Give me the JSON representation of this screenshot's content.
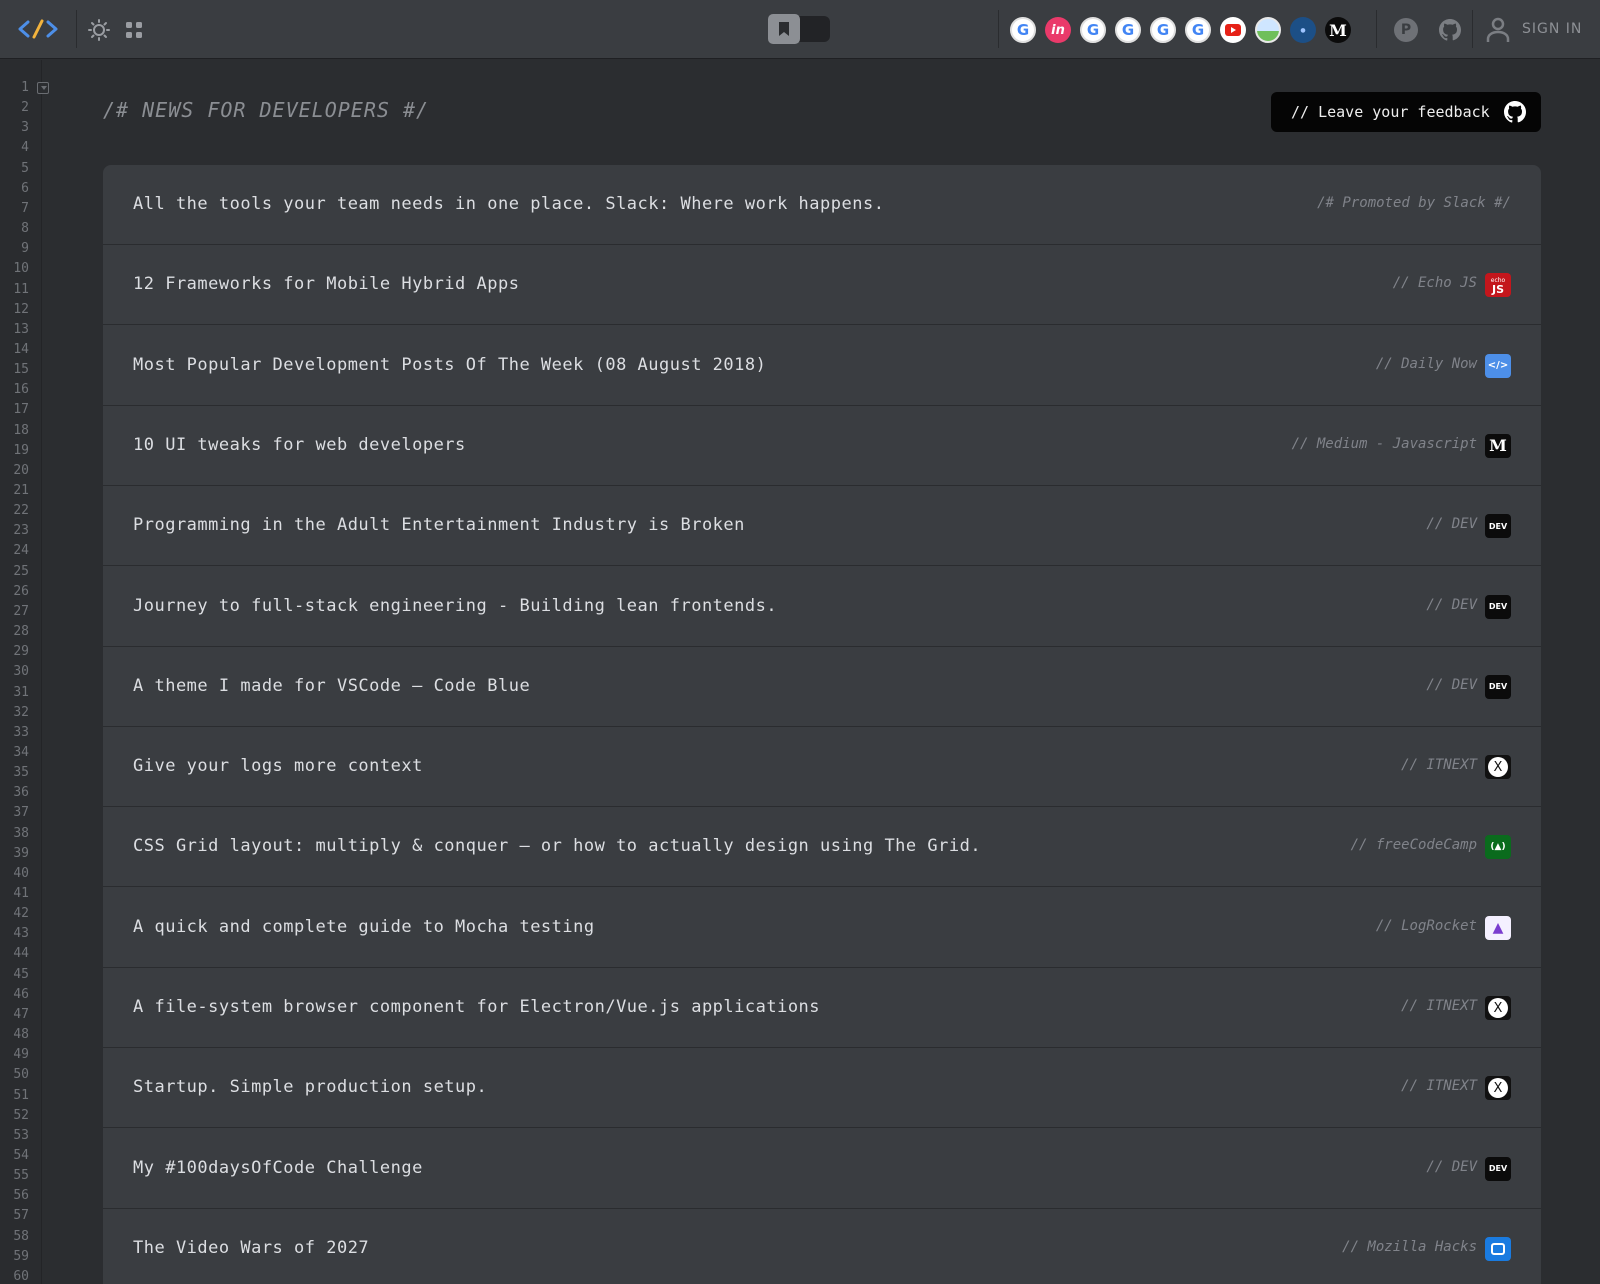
{
  "topbar": {
    "signin_label": "SIGN IN",
    "theme_icon": "sun-icon",
    "apps_icon": "grid-icon",
    "bookmark_icon": "bookmark-icon",
    "sources": [
      {
        "icon": "google-icon",
        "label": "G"
      },
      {
        "icon": "invision-icon",
        "label": "in"
      },
      {
        "icon": "google-icon",
        "label": "G"
      },
      {
        "icon": "google-icon",
        "label": "G"
      },
      {
        "icon": "google-icon",
        "label": "G"
      },
      {
        "icon": "google-icon",
        "label": "G"
      },
      {
        "icon": "youtube-icon",
        "label": ""
      },
      {
        "icon": "photo-icon",
        "label": ""
      },
      {
        "icon": "hashnode-icon",
        "label": ""
      },
      {
        "icon": "medium-icon",
        "label": "M"
      }
    ]
  },
  "gutter": {
    "lines": [
      "1",
      "2",
      "3",
      "4",
      "5",
      "6",
      "7",
      "8",
      "9",
      "10",
      "11",
      "12",
      "13",
      "14",
      "15",
      "16",
      "17",
      "18",
      "19",
      "20",
      "21",
      "22",
      "23",
      "24",
      "25",
      "26",
      "27",
      "28",
      "29",
      "30",
      "31",
      "32",
      "33",
      "34",
      "35",
      "36",
      "37",
      "38",
      "39",
      "40",
      "41",
      "42",
      "43",
      "44",
      "45",
      "46",
      "47",
      "48",
      "49",
      "50",
      "51",
      "52",
      "53",
      "54",
      "55",
      "56",
      "57",
      "58",
      "59",
      "60"
    ]
  },
  "main": {
    "title": "/# NEWS FOR DEVELOPERS #/",
    "feedback_label": "// Leave your feedback"
  },
  "feed": [
    {
      "title": "All the tools your team needs in one place. Slack: Where work happens.",
      "source": "/# Promoted by Slack #/",
      "badge": "none",
      "badge_text": ""
    },
    {
      "title": "12 Frameworks for Mobile Hybrid Apps",
      "source": "// Echo JS",
      "badge": "echo",
      "badge_text": "JS"
    },
    {
      "title": "Most Popular Development Posts Of The Week (08 August 2018)",
      "source": "// Daily Now",
      "badge": "daily",
      "badge_text": "</>"
    },
    {
      "title": "10 UI tweaks for web developers",
      "source": "// Medium - Javascript",
      "badge": "medium",
      "badge_text": "M"
    },
    {
      "title": "Programming in the Adult Entertainment Industry is Broken",
      "source": "// DEV",
      "badge": "dev",
      "badge_text": "DEV"
    },
    {
      "title": "Journey to full-stack engineering - Building lean frontends.",
      "source": "// DEV",
      "badge": "dev",
      "badge_text": "DEV"
    },
    {
      "title": "A theme I made for VSCode — Code Blue",
      "source": "// DEV",
      "badge": "dev",
      "badge_text": "DEV"
    },
    {
      "title": "Give your logs more context",
      "source": "// ITNEXT",
      "badge": "itnext",
      "badge_text": "X"
    },
    {
      "title": "CSS Grid layout: multiply & conquer — or how to actually design using The Grid.",
      "source": "// freeCodeCamp",
      "badge": "fcc",
      "badge_text": "(▲)"
    },
    {
      "title": "A quick and complete guide to Mocha testing",
      "source": "// LogRocket",
      "badge": "lr",
      "badge_text": "▲"
    },
    {
      "title": "A file-system browser component for Electron/Vue.js applications",
      "source": "// ITNEXT",
      "badge": "itnext",
      "badge_text": "X"
    },
    {
      "title": "Startup. Simple production setup.",
      "source": "// ITNEXT",
      "badge": "itnext",
      "badge_text": "X"
    },
    {
      "title": "My #100daysOfCode Challenge",
      "source": "// DEV",
      "badge": "dev",
      "badge_text": "DEV"
    },
    {
      "title": "The Video Wars of 2027",
      "source": "// Mozilla Hacks",
      "badge": "moz",
      "badge_text": ""
    }
  ]
}
